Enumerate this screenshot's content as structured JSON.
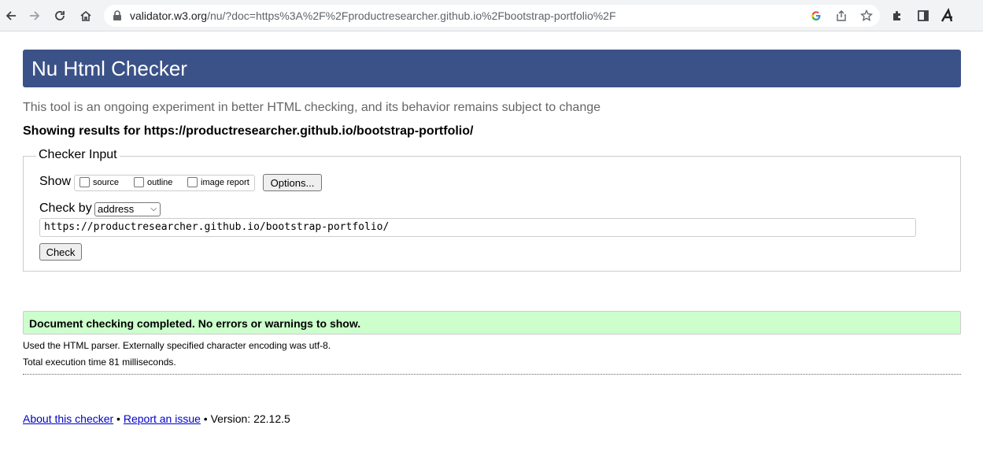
{
  "browser": {
    "url_host": "validator.w3.org",
    "url_rest": "/nu/?doc=https%3A%2F%2Fproductresearcher.github.io%2Fbootstrap-portfolio%2F",
    "icons": [
      "back-icon",
      "forward-icon",
      "reload-icon",
      "home-icon",
      "lock-icon",
      "google-icon",
      "share-icon",
      "star-icon",
      "puzzle-icon",
      "sidebar-icon",
      "profile-icon"
    ]
  },
  "page": {
    "title": "Nu Html Checker",
    "subtitle": "This tool is an ongoing experiment in better HTML checking, and its behavior remains subject to change",
    "results_for": "Showing results for https://productresearcher.github.io/bootstrap-portfolio/"
  },
  "checker_input": {
    "legend": "Checker Input",
    "show_label": "Show",
    "checkboxes": [
      {
        "label": "source",
        "checked": false
      },
      {
        "label": "outline",
        "checked": false
      },
      {
        "label": "image report",
        "checked": false
      }
    ],
    "options_button": "Options...",
    "check_by_label": "Check by",
    "check_by_value": "address",
    "url_value": "https://productresearcher.github.io/bootstrap-portfolio/",
    "check_button": "Check"
  },
  "results": {
    "status": "Document checking completed. No errors or warnings to show.",
    "parser_note": "Used the HTML parser. Externally specified character encoding was utf-8.",
    "execution_time": "Total execution time 81 milliseconds."
  },
  "footer": {
    "about_link": "About this checker",
    "separator1": " • ",
    "report_link": "Report an issue",
    "version": " • Version: 22.12.5"
  },
  "colors": {
    "title_bar": "#3b5288",
    "success_bg": "#ccffcc",
    "link": "#0000cc"
  }
}
